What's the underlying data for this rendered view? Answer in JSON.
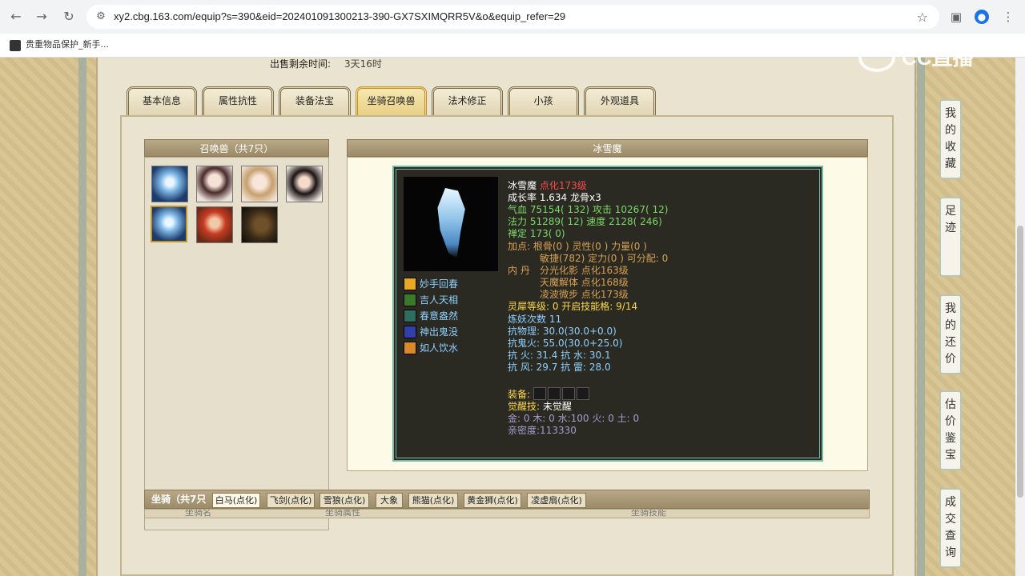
{
  "browser": {
    "url": "xy2.cbg.163.com/equip?s=390&eid=202401091300213-390-GX7SXIMQRR5V&o&equip_refer=29",
    "bookmark_label": "贵重物品保护_新手..."
  },
  "watermark": {
    "text": "CC直播"
  },
  "sale": {
    "label": "出售剩余时间:",
    "value": "3天16时"
  },
  "tabs": [
    "基本信息",
    "属性抗性",
    "装备法宝",
    "坐骑召唤兽",
    "法术修正",
    "小孩",
    "外观道具"
  ],
  "active_tab": "坐骑召唤兽",
  "pets_box": {
    "title": "召唤兽（共7只）"
  },
  "detail": {
    "title": "冰雪魔",
    "name": "冰雪魔",
    "level": "点化173级",
    "growth": "成长率 1.634 龙骨x3",
    "hp_label": "气血",
    "hp": "75154( 132)",
    "atk_label": "攻击",
    "atk": "10267( 12)",
    "mp_label": "法力",
    "mp": "51289( 12)",
    "spd_label": "速度",
    "spd": "2128( 246)",
    "calm": "禅定 173( 0)",
    "points_line1": "加点:  根骨(0 ) 灵性(0 ) 力量(0 )",
    "points_line2": "敏捷(782) 定力(0 ) 可分配:  0",
    "inner_label": "内  丹",
    "inner1": "分光化影 点化163级",
    "inner2": "天魔解体 点化168级",
    "inner3": "凌波微步 点化173级",
    "spirit": "灵犀等级:  0 开启技能格:  9/14",
    "refine": "炼妖次数 11",
    "res_physical": "抗物理: 30.0(30.0+0.0)",
    "res_ghost": "抗鬼火: 55.0(30.0+25.0)",
    "res_line1": "抗    火: 31.4 抗    水: 30.1",
    "res_line2": "抗    风: 29.7 抗    雷: 28.0",
    "equip_label": "装备:",
    "awaken_label": "觉醒技:",
    "awaken_value": "未觉醒",
    "elements": "金: 0 木: 0 水:100 火: 0 土: 0",
    "intimacy": "亲密度:113330",
    "skills": [
      "妙手回春",
      "吉人天相",
      "春意盎然",
      "神出鬼没",
      "如人饮水"
    ]
  },
  "mounts": {
    "title": "坐骑（共7只",
    "tabs": [
      "白马(点化)",
      "飞剑(点化)",
      "雪狼(点化)",
      "大象",
      "熊猫(点化)",
      "黄金狮(点化)",
      "凌虚扇(点化)"
    ],
    "columns": [
      "坐骑名",
      "坐骑属性",
      "坐骑技能"
    ]
  },
  "side_buttons": [
    "我的收藏",
    "足迹",
    "我的还价",
    "估价鉴宝",
    "成交查询"
  ]
}
